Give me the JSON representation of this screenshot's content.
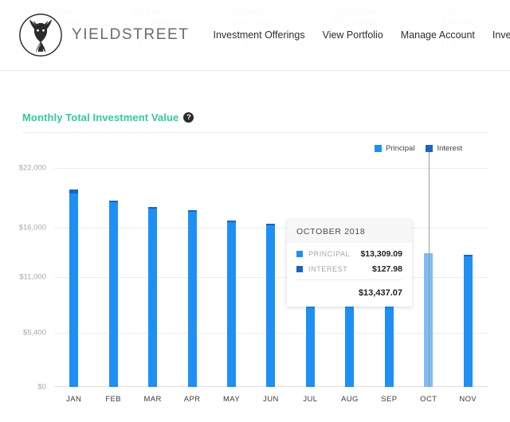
{
  "header": {
    "logo_text": "YIELDSTREET",
    "logo_icon": "deer-head-logo",
    "nav": [
      {
        "label": "Investment Offerings"
      },
      {
        "label": "View Portfolio"
      },
      {
        "label": "Manage Account"
      },
      {
        "label": "Investme"
      }
    ]
  },
  "background_summary": [
    {
      "label": "PRINCIPAL\nOUTSTANDING",
      "value": "$19,390.48"
    },
    {
      "label": "INTEREST\nOUTSTANDING",
      "value": "$306.04"
    },
    {
      "label": "PRINCIPAL\nACCRUED",
      "value": "$0.00"
    },
    {
      "label": "PRINCIPAL\nRETURNED",
      "value": "$6,081.39"
    },
    {
      "label": "INTEREST\nEARNED",
      "value": "$1,808.88"
    }
  ],
  "card": {
    "title": "Monthly Total Investment Value",
    "help_icon": "?"
  },
  "legend": [
    {
      "label": "Principal",
      "color": "#1e90f5"
    },
    {
      "label": "Interest",
      "color": "#1565c9"
    }
  ],
  "tooltip": {
    "title": "OCTOBER 2018",
    "rows": [
      {
        "name": "PRINCIPAL",
        "value": "$13,309.09",
        "color": "#1e90f5"
      },
      {
        "name": "INTEREST",
        "value": "$127.98",
        "color": "#1565c9"
      }
    ],
    "total": "$13,437.07"
  },
  "chart_data": {
    "type": "bar",
    "stacked": true,
    "title": "Monthly Total Investment Value",
    "xlabel": "",
    "ylabel": "",
    "ylim": [
      0,
      23000
    ],
    "grid": true,
    "legend_position": "top-right",
    "ytick_labels": [
      "$22,000",
      "$16,000",
      "$11,000",
      "$5,400",
      "$0"
    ],
    "ytick_values": [
      22000,
      16000,
      11000,
      5400,
      0
    ],
    "categories": [
      "JAN",
      "FEB",
      "MAR",
      "AUG",
      "APR",
      "MAY",
      "JUN",
      "JUL",
      "SEP",
      "OCT",
      "NOV"
    ],
    "x": [
      "JAN",
      "FEB",
      "MAR",
      "APR",
      "MAY",
      "JUN",
      "JUL",
      "AUG",
      "SEP",
      "OCT",
      "NOV"
    ],
    "highlighted_category": "OCT",
    "series": [
      {
        "name": "Principal",
        "color": "#1e90f5",
        "values": [
          19390.48,
          18520.0,
          17900.0,
          17600.0,
          16550.0,
          16250.0,
          14900.0,
          14900.0,
          14800.0,
          13309.09,
          13100.0
        ]
      },
      {
        "name": "Interest",
        "color": "#1565c9",
        "values": [
          450.0,
          200.0,
          160.0,
          130.0,
          120.0,
          110.0,
          130.0,
          130.0,
          210.0,
          127.98,
          140.0
        ]
      }
    ],
    "totals": [
      19840.48,
      18720.0,
      18060.0,
      17730.0,
      16670.0,
      16360.0,
      15030.0,
      15030.0,
      15010.0,
      13437.07,
      13240.0
    ]
  }
}
